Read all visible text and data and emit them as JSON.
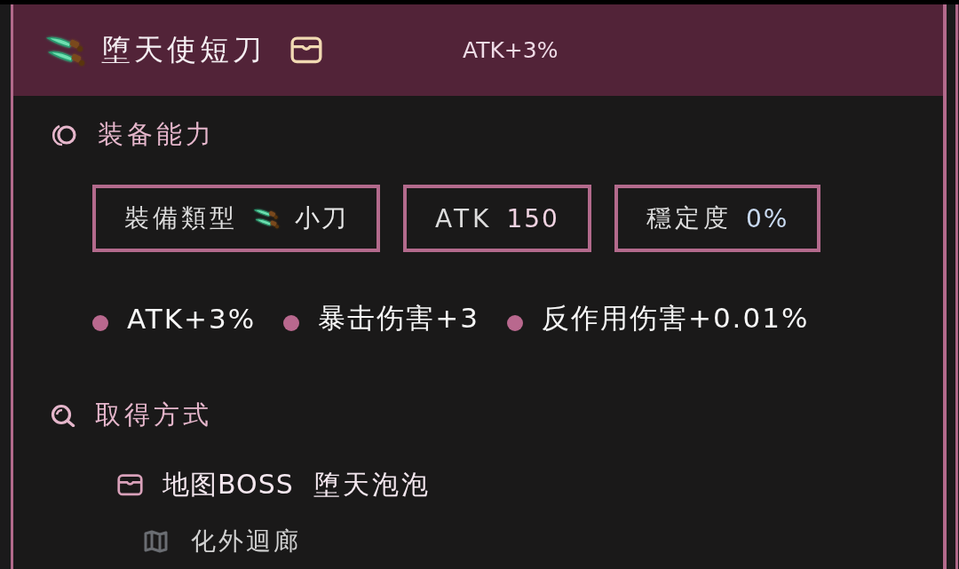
{
  "card": {
    "title": "堕天使短刀",
    "bonus": "ATK+3%"
  },
  "sections": [
    {
      "kind": "ability",
      "heading": "装备能力",
      "stats": [
        {
          "kind": "type",
          "label": "裝備類型",
          "value": "小刀"
        },
        {
          "kind": "atk",
          "label": "ATK",
          "value": "150"
        },
        {
          "kind": "stability",
          "label": "穩定度",
          "value": "0%"
        }
      ],
      "effects": [
        "ATK+3%",
        "暴击伤害+3",
        "反作用伤害+0.01%"
      ]
    },
    {
      "kind": "source",
      "heading": "取得方式",
      "sources": [
        {
          "type": "地图BOSS",
          "name": "堕天泡泡",
          "location": "化外迴廊"
        }
      ]
    }
  ]
}
